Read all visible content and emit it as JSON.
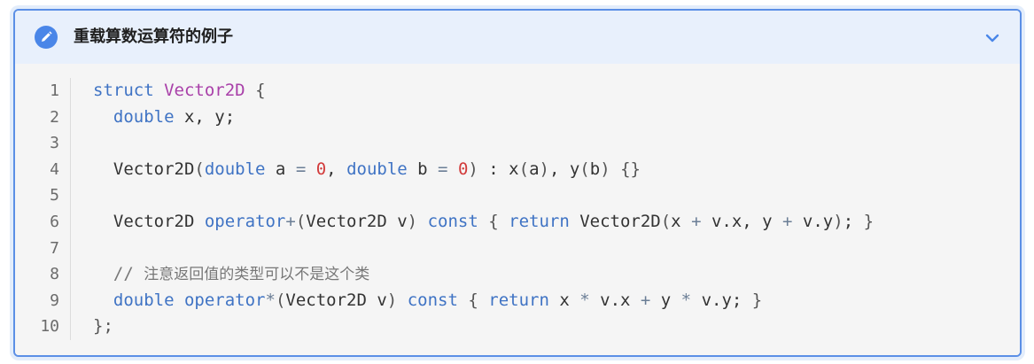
{
  "header": {
    "title": "重载算数运算符的例子",
    "icon": "pencil-icon",
    "toggle_icon": "chevron-down-icon",
    "accent_color": "#5b8fe6"
  },
  "code": {
    "line_numbers": [
      "1",
      "2",
      "3",
      "4",
      "5",
      "6",
      "7",
      "8",
      "9",
      "10"
    ],
    "lines": [
      [
        {
          "cls": "kw",
          "text": "struct"
        },
        {
          "cls": "",
          "text": " "
        },
        {
          "cls": "ty",
          "text": "Vector2D"
        },
        {
          "cls": "",
          "text": " "
        },
        {
          "cls": "pn",
          "text": "{"
        }
      ],
      [
        {
          "cls": "",
          "text": "  "
        },
        {
          "cls": "kw",
          "text": "double"
        },
        {
          "cls": "",
          "text": " x, y;"
        }
      ],
      [],
      [
        {
          "cls": "",
          "text": "  Vector2D"
        },
        {
          "cls": "pn",
          "text": "("
        },
        {
          "cls": "kw",
          "text": "double"
        },
        {
          "cls": "",
          "text": " a "
        },
        {
          "cls": "op",
          "text": "="
        },
        {
          "cls": "",
          "text": " "
        },
        {
          "cls": "nm",
          "text": "0"
        },
        {
          "cls": "",
          "text": ", "
        },
        {
          "cls": "kw",
          "text": "double"
        },
        {
          "cls": "",
          "text": " b "
        },
        {
          "cls": "op",
          "text": "="
        },
        {
          "cls": "",
          "text": " "
        },
        {
          "cls": "nm",
          "text": "0"
        },
        {
          "cls": "pn",
          "text": ")"
        },
        {
          "cls": "",
          "text": " : x"
        },
        {
          "cls": "pn",
          "text": "("
        },
        {
          "cls": "",
          "text": "a"
        },
        {
          "cls": "pn",
          "text": ")"
        },
        {
          "cls": "",
          "text": ", y"
        },
        {
          "cls": "pn",
          "text": "("
        },
        {
          "cls": "",
          "text": "b"
        },
        {
          "cls": "pn",
          "text": ")"
        },
        {
          "cls": "",
          "text": " "
        },
        {
          "cls": "pn",
          "text": "{}"
        }
      ],
      [],
      [
        {
          "cls": "",
          "text": "  Vector2D "
        },
        {
          "cls": "kw",
          "text": "operator"
        },
        {
          "cls": "op",
          "text": "+"
        },
        {
          "cls": "pn",
          "text": "("
        },
        {
          "cls": "",
          "text": "Vector2D v"
        },
        {
          "cls": "pn",
          "text": ")"
        },
        {
          "cls": "",
          "text": " "
        },
        {
          "cls": "kw",
          "text": "const"
        },
        {
          "cls": "",
          "text": " "
        },
        {
          "cls": "pn",
          "text": "{"
        },
        {
          "cls": "",
          "text": " "
        },
        {
          "cls": "kw",
          "text": "return"
        },
        {
          "cls": "",
          "text": " Vector2D"
        },
        {
          "cls": "pn",
          "text": "("
        },
        {
          "cls": "",
          "text": "x "
        },
        {
          "cls": "op",
          "text": "+"
        },
        {
          "cls": "",
          "text": " v.x, y "
        },
        {
          "cls": "op",
          "text": "+"
        },
        {
          "cls": "",
          "text": " v.y"
        },
        {
          "cls": "pn",
          "text": ")"
        },
        {
          "cls": "",
          "text": "; "
        },
        {
          "cls": "pn",
          "text": "}"
        }
      ],
      [],
      [
        {
          "cls": "",
          "text": "  "
        },
        {
          "cls": "cm",
          "text": "// "
        },
        {
          "cls": "cm-zh",
          "text": "注意返回值的类型可以不是这个类"
        }
      ],
      [
        {
          "cls": "",
          "text": "  "
        },
        {
          "cls": "kw",
          "text": "double"
        },
        {
          "cls": "",
          "text": " "
        },
        {
          "cls": "kw",
          "text": "operator"
        },
        {
          "cls": "op",
          "text": "*"
        },
        {
          "cls": "pn",
          "text": "("
        },
        {
          "cls": "",
          "text": "Vector2D v"
        },
        {
          "cls": "pn",
          "text": ")"
        },
        {
          "cls": "",
          "text": " "
        },
        {
          "cls": "kw",
          "text": "const"
        },
        {
          "cls": "",
          "text": " "
        },
        {
          "cls": "pn",
          "text": "{"
        },
        {
          "cls": "",
          "text": " "
        },
        {
          "cls": "kw",
          "text": "return"
        },
        {
          "cls": "",
          "text": " x "
        },
        {
          "cls": "op",
          "text": "*"
        },
        {
          "cls": "",
          "text": " v.x "
        },
        {
          "cls": "op",
          "text": "+"
        },
        {
          "cls": "",
          "text": " y "
        },
        {
          "cls": "op",
          "text": "*"
        },
        {
          "cls": "",
          "text": " v.y; "
        },
        {
          "cls": "pn",
          "text": "}"
        }
      ],
      [
        {
          "cls": "pn",
          "text": "};"
        }
      ]
    ]
  }
}
